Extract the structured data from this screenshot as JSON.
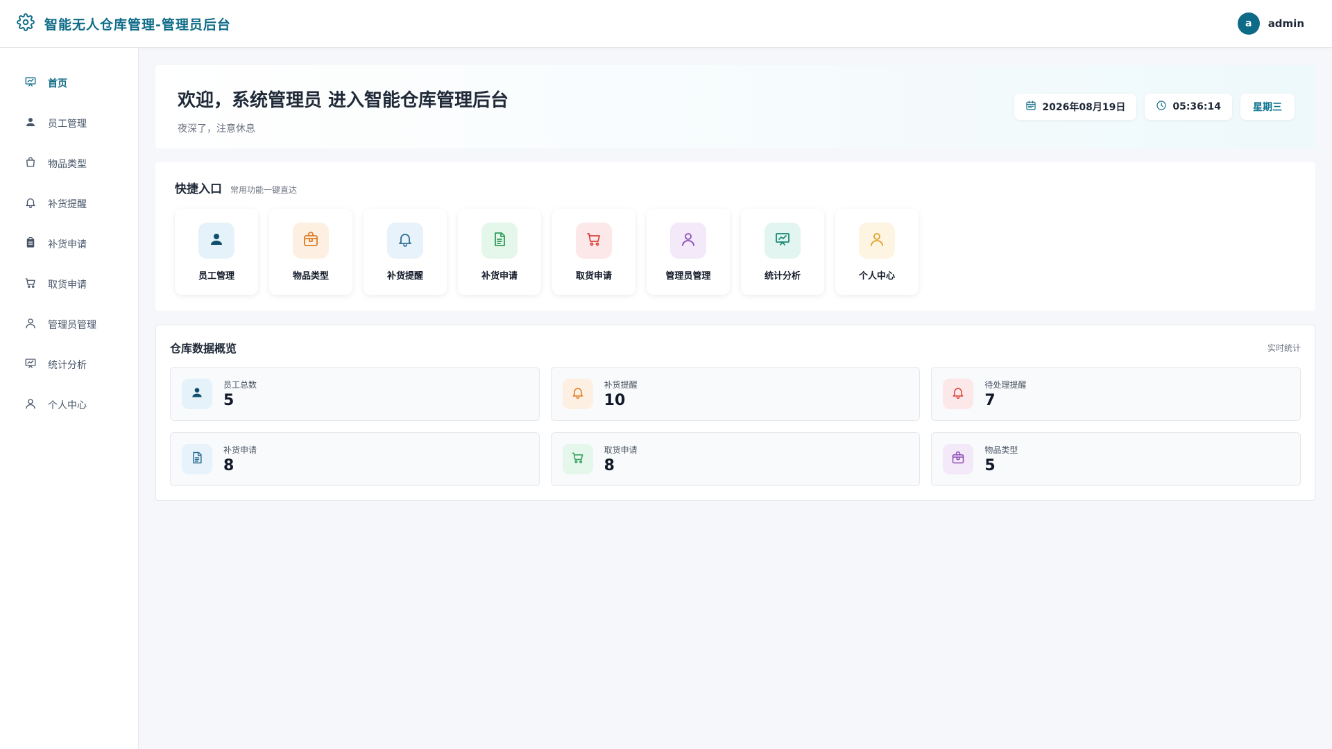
{
  "header": {
    "title": "智能无人仓库管理-管理员后台",
    "logo_icon": "gear-icon",
    "avatar_letter": "a",
    "username": "admin",
    "accent": "#0e6b87"
  },
  "sidebar": {
    "items": [
      {
        "label": "首页",
        "icon": "chart-board-icon",
        "active": true
      },
      {
        "label": "员工管理",
        "icon": "user-filled-icon"
      },
      {
        "label": "物品类型",
        "icon": "bag-icon"
      },
      {
        "label": "补货提醒",
        "icon": "bell-icon"
      },
      {
        "label": "补货申请",
        "icon": "clipboard-icon"
      },
      {
        "label": "取货申请",
        "icon": "cart-icon"
      },
      {
        "label": "管理员管理",
        "icon": "user-outline-icon"
      },
      {
        "label": "统计分析",
        "icon": "chart-board-icon"
      },
      {
        "label": "个人中心",
        "icon": "user-outline-icon"
      }
    ]
  },
  "welcome": {
    "title": "欢迎，系统管理员 进入智能仓库管理后台",
    "subtitle": "夜深了，注意休息",
    "date": "2026年08月19日",
    "time": "05:36:14",
    "weekday": "星期三"
  },
  "quick": {
    "title": "快捷入口",
    "subtitle": "常用功能一键直达",
    "items": [
      {
        "label": "员工管理",
        "icon": "user-filled-icon",
        "color": "#0e4f6b",
        "bg": "#e6f2f9"
      },
      {
        "label": "物品类型",
        "icon": "box-icon",
        "color": "#e07b24",
        "bg": "#fdf0e3"
      },
      {
        "label": "补货提醒",
        "icon": "bell-icon",
        "color": "#2b6d93",
        "bg": "#e8f2fa"
      },
      {
        "label": "补货申请",
        "icon": "document-icon",
        "color": "#2f9e5b",
        "bg": "#e5f6ea"
      },
      {
        "label": "取货申请",
        "icon": "cart-icon",
        "color": "#d9413a",
        "bg": "#fce8e8"
      },
      {
        "label": "管理员管理",
        "icon": "user-outline-icon",
        "color": "#8b4bb8",
        "bg": "#f3e9f8"
      },
      {
        "label": "统计分析",
        "icon": "chart-board-icon",
        "color": "#168a73",
        "bg": "#e3f5f0"
      },
      {
        "label": "个人中心",
        "icon": "user-outline-icon",
        "color": "#e0a12b",
        "bg": "#fdf4e1"
      }
    ]
  },
  "overview": {
    "title": "仓库数据概览",
    "tag": "实时统计",
    "stats": [
      {
        "label": "员工总数",
        "value": "5",
        "icon": "user-filled-icon",
        "color": "#0e4f6b",
        "bg": "#e6f2f9"
      },
      {
        "label": "补货提醒",
        "value": "10",
        "icon": "bell-icon",
        "color": "#e07b24",
        "bg": "#fdf0e3"
      },
      {
        "label": "待处理提醒",
        "value": "7",
        "icon": "bell-icon",
        "color": "#d9413a",
        "bg": "#fce8e8"
      },
      {
        "label": "补货申请",
        "value": "8",
        "icon": "document-icon",
        "color": "#2b6d93",
        "bg": "#e8f2fa"
      },
      {
        "label": "取货申请",
        "value": "8",
        "icon": "cart-icon",
        "color": "#2f9e5b",
        "bg": "#e5f6ea"
      },
      {
        "label": "物品类型",
        "value": "5",
        "icon": "box-icon",
        "color": "#8b4bb8",
        "bg": "#f3e9f8"
      }
    ]
  }
}
